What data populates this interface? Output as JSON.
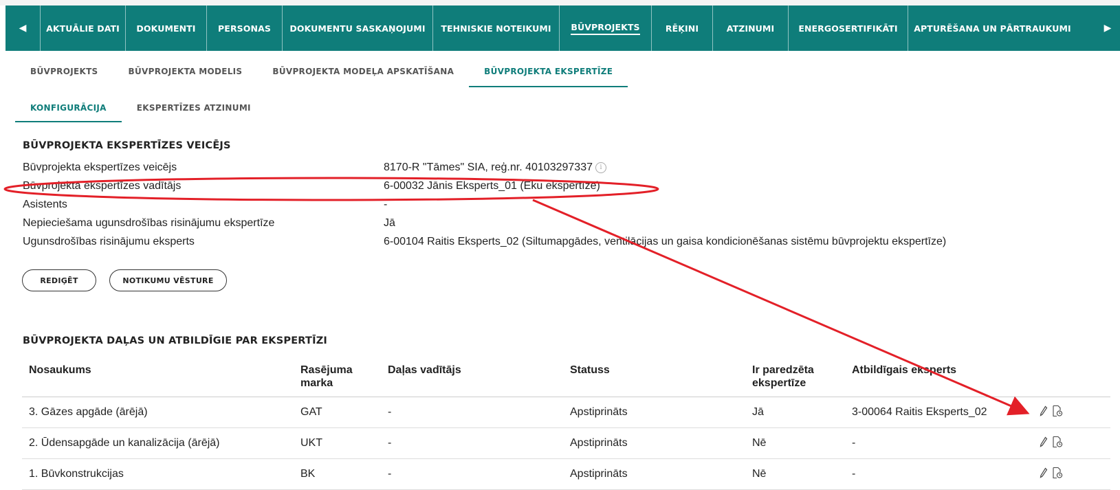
{
  "nav": {
    "items": [
      {
        "label": "AKTUĀLIE DATI"
      },
      {
        "label": "DOKUMENTI"
      },
      {
        "label": "PERSONAS"
      },
      {
        "label": "DOKUMENTU SASKAŅOJUMI"
      },
      {
        "label": "TEHNISKIE NOTEIKUMI"
      },
      {
        "label": "BŪVPROJEKTS"
      },
      {
        "label": "RĒĶINI"
      },
      {
        "label": "ATZINUMI"
      },
      {
        "label": "ENERGOSERTIFIKĀTI"
      },
      {
        "label": "APTURĒŠANA UN PĀRTRAUKUMI"
      }
    ],
    "active": "BŪVPROJEKTS"
  },
  "subtabs": [
    {
      "label": "BŪVPROJEKTS"
    },
    {
      "label": "BŪVPROJEKTA MODELIS"
    },
    {
      "label": "BŪVPROJEKTA MODEĻA APSKATĪŠANA"
    },
    {
      "label": "BŪVPROJEKTA EKSPERTĪZE"
    }
  ],
  "subtabs2": [
    {
      "label": "KONFIGURĀCIJA"
    },
    {
      "label": "EKSPERTĪZES ATZINUMI"
    }
  ],
  "expertise": {
    "title": "BŪVPROJEKTA EKSPERTĪZES VEICĒJS",
    "rows": [
      {
        "label": "Būvprojekta ekspertīzes veicējs",
        "value": "8170-R \"Tāmes\" SIA, reģ.nr. 40103297337"
      },
      {
        "label": "Būvprojekta ekspertīzes vadītājs",
        "value": "6-00032 Jānis Eksperts_01 (Ēku ekspertīze)"
      },
      {
        "label": "Asistents",
        "value": "-"
      },
      {
        "label": "Nepieciešama ugunsdrošības risinājumu ekspertīze",
        "value": "Jā"
      },
      {
        "label": "Ugunsdrošības risinājumu eksperts",
        "value": "6-00104 Raitis Eksperts_02 (Siltumapgādes, ventilācijas un gaisa kondicionēšanas sistēmu būvprojektu ekspertīze)"
      }
    ],
    "edit_label": "REDIĢĒT",
    "history_label": "NOTIKUMU VĒSTURE"
  },
  "parts": {
    "title": "BŪVPROJEKTA DAĻAS UN ATBILDĪGIE PAR EKSPERTĪZI",
    "columns": [
      "Nosaukums",
      "Rasējuma marka",
      "Daļas vadītājs",
      "Statuss",
      "Ir paredzēta ekspertīze",
      "Atbildīgais eksperts"
    ],
    "rows": [
      [
        "3. Gāzes apgāde (ārējā)",
        "GAT",
        "-",
        "Apstiprināts",
        "Jā",
        "3-00064 Raitis Eksperts_02"
      ],
      [
        "2. Ūdensapgāde un kanalizācija (ārējā)",
        "UKT",
        "-",
        "Apstiprināts",
        "Nē",
        "-"
      ],
      [
        "1. Būvkonstrukcijas",
        "BK",
        "-",
        "Apstiprināts",
        "Nē",
        "-"
      ]
    ]
  },
  "colors": {
    "accent": "#0f7d7a",
    "annotation": "#e32028"
  },
  "icons": {
    "prev": "chevron-left-icon",
    "next": "chevron-right-icon",
    "info": "info-icon",
    "edit": "pencil-icon",
    "history": "document-history-icon"
  }
}
